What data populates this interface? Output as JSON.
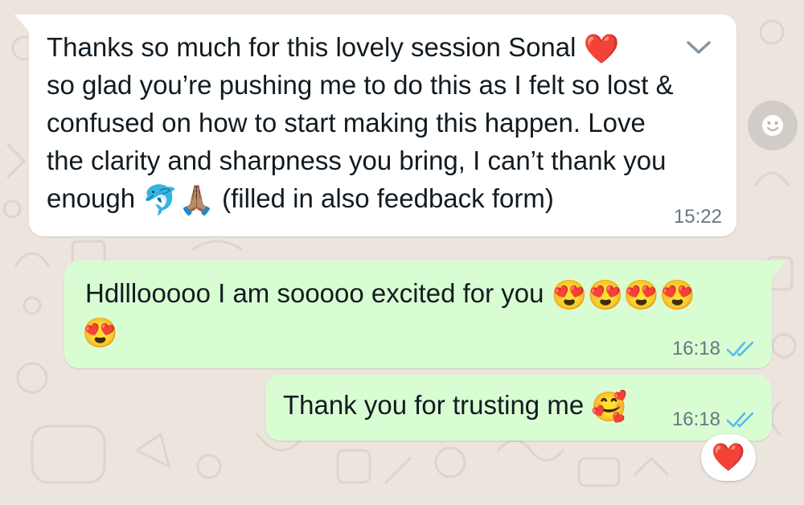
{
  "messages": [
    {
      "direction": "incoming",
      "lines": [
        "Thanks so much for this lovely session Sonal",
        "so glad you’re pushing me to do this as I felt so lost &",
        "confused on how to start making this happen. Love",
        "the clarity and sharpness you bring, I can’t thank you",
        "enough",
        "(filled in also feedback form)"
      ],
      "emojis": [
        "❤️",
        "🐬",
        "🙏🏽"
      ],
      "time": "15:22"
    },
    {
      "direction": "outgoing",
      "lines": [
        "Hdlllooooo I am sooooo excited for you"
      ],
      "emojis": [
        "😍😍😍😍",
        "😍"
      ],
      "time": "16:18",
      "status": "read"
    },
    {
      "direction": "outgoing",
      "lines": [
        "Thank you for trusting me"
      ],
      "emojis": [
        "🥰"
      ],
      "time": "16:18",
      "status": "read",
      "reaction": "❤️"
    }
  ],
  "icons": {
    "menu": "chevron-down-icon",
    "react": "smiley-icon",
    "read": "double-check-icon"
  },
  "colors": {
    "background": "#ece5dd",
    "incoming": "#ffffff",
    "outgoing": "#d9fdd3",
    "read_ticks": "#53bdeb",
    "meta": "#667781"
  }
}
